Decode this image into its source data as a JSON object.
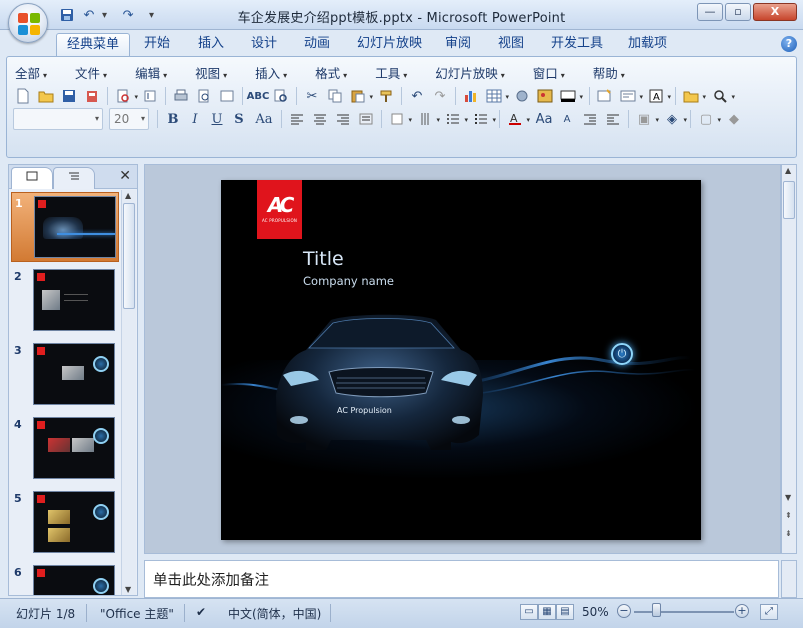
{
  "window": {
    "title": "车企发展史介绍ppt模板.pptx - Microsoft PowerPoint",
    "controls": {
      "minimize": "—",
      "maximize": "▫",
      "close": "X"
    }
  },
  "qat": {
    "undo_icon": "↶",
    "redo_icon": "↷",
    "more": "▾"
  },
  "ribbon": {
    "tabs": [
      "经典菜单",
      "开始",
      "插入",
      "设计",
      "动画",
      "幻灯片放映",
      "审阅",
      "视图",
      "开发工具",
      "加载项"
    ],
    "active_tab": "经典菜单",
    "help": "?"
  },
  "menubar": {
    "items": [
      "全部",
      "文件",
      "编辑",
      "视图",
      "插入",
      "格式",
      "工具",
      "幻灯片放映",
      "窗口",
      "帮助"
    ]
  },
  "format": {
    "font_name": "",
    "font_size": "20",
    "buttons": [
      "B",
      "I",
      "U",
      "S",
      "Aa"
    ]
  },
  "thumbnails": {
    "numbers": [
      "1",
      "2",
      "3",
      "4",
      "5",
      "6"
    ],
    "selected": "1"
  },
  "slide": {
    "logo_mark": "AC",
    "logo_text": "AC PROPULSION",
    "title": "Title",
    "company": "Company name",
    "car_label": "AC Propulsion",
    "power_icon": "⏻"
  },
  "notes": {
    "placeholder": "单击此处添加备注"
  },
  "status": {
    "slide_count": "幻灯片 1/8",
    "theme": "\"Office 主题\"",
    "language": "中文(简体，中国)",
    "zoom": "50%"
  }
}
